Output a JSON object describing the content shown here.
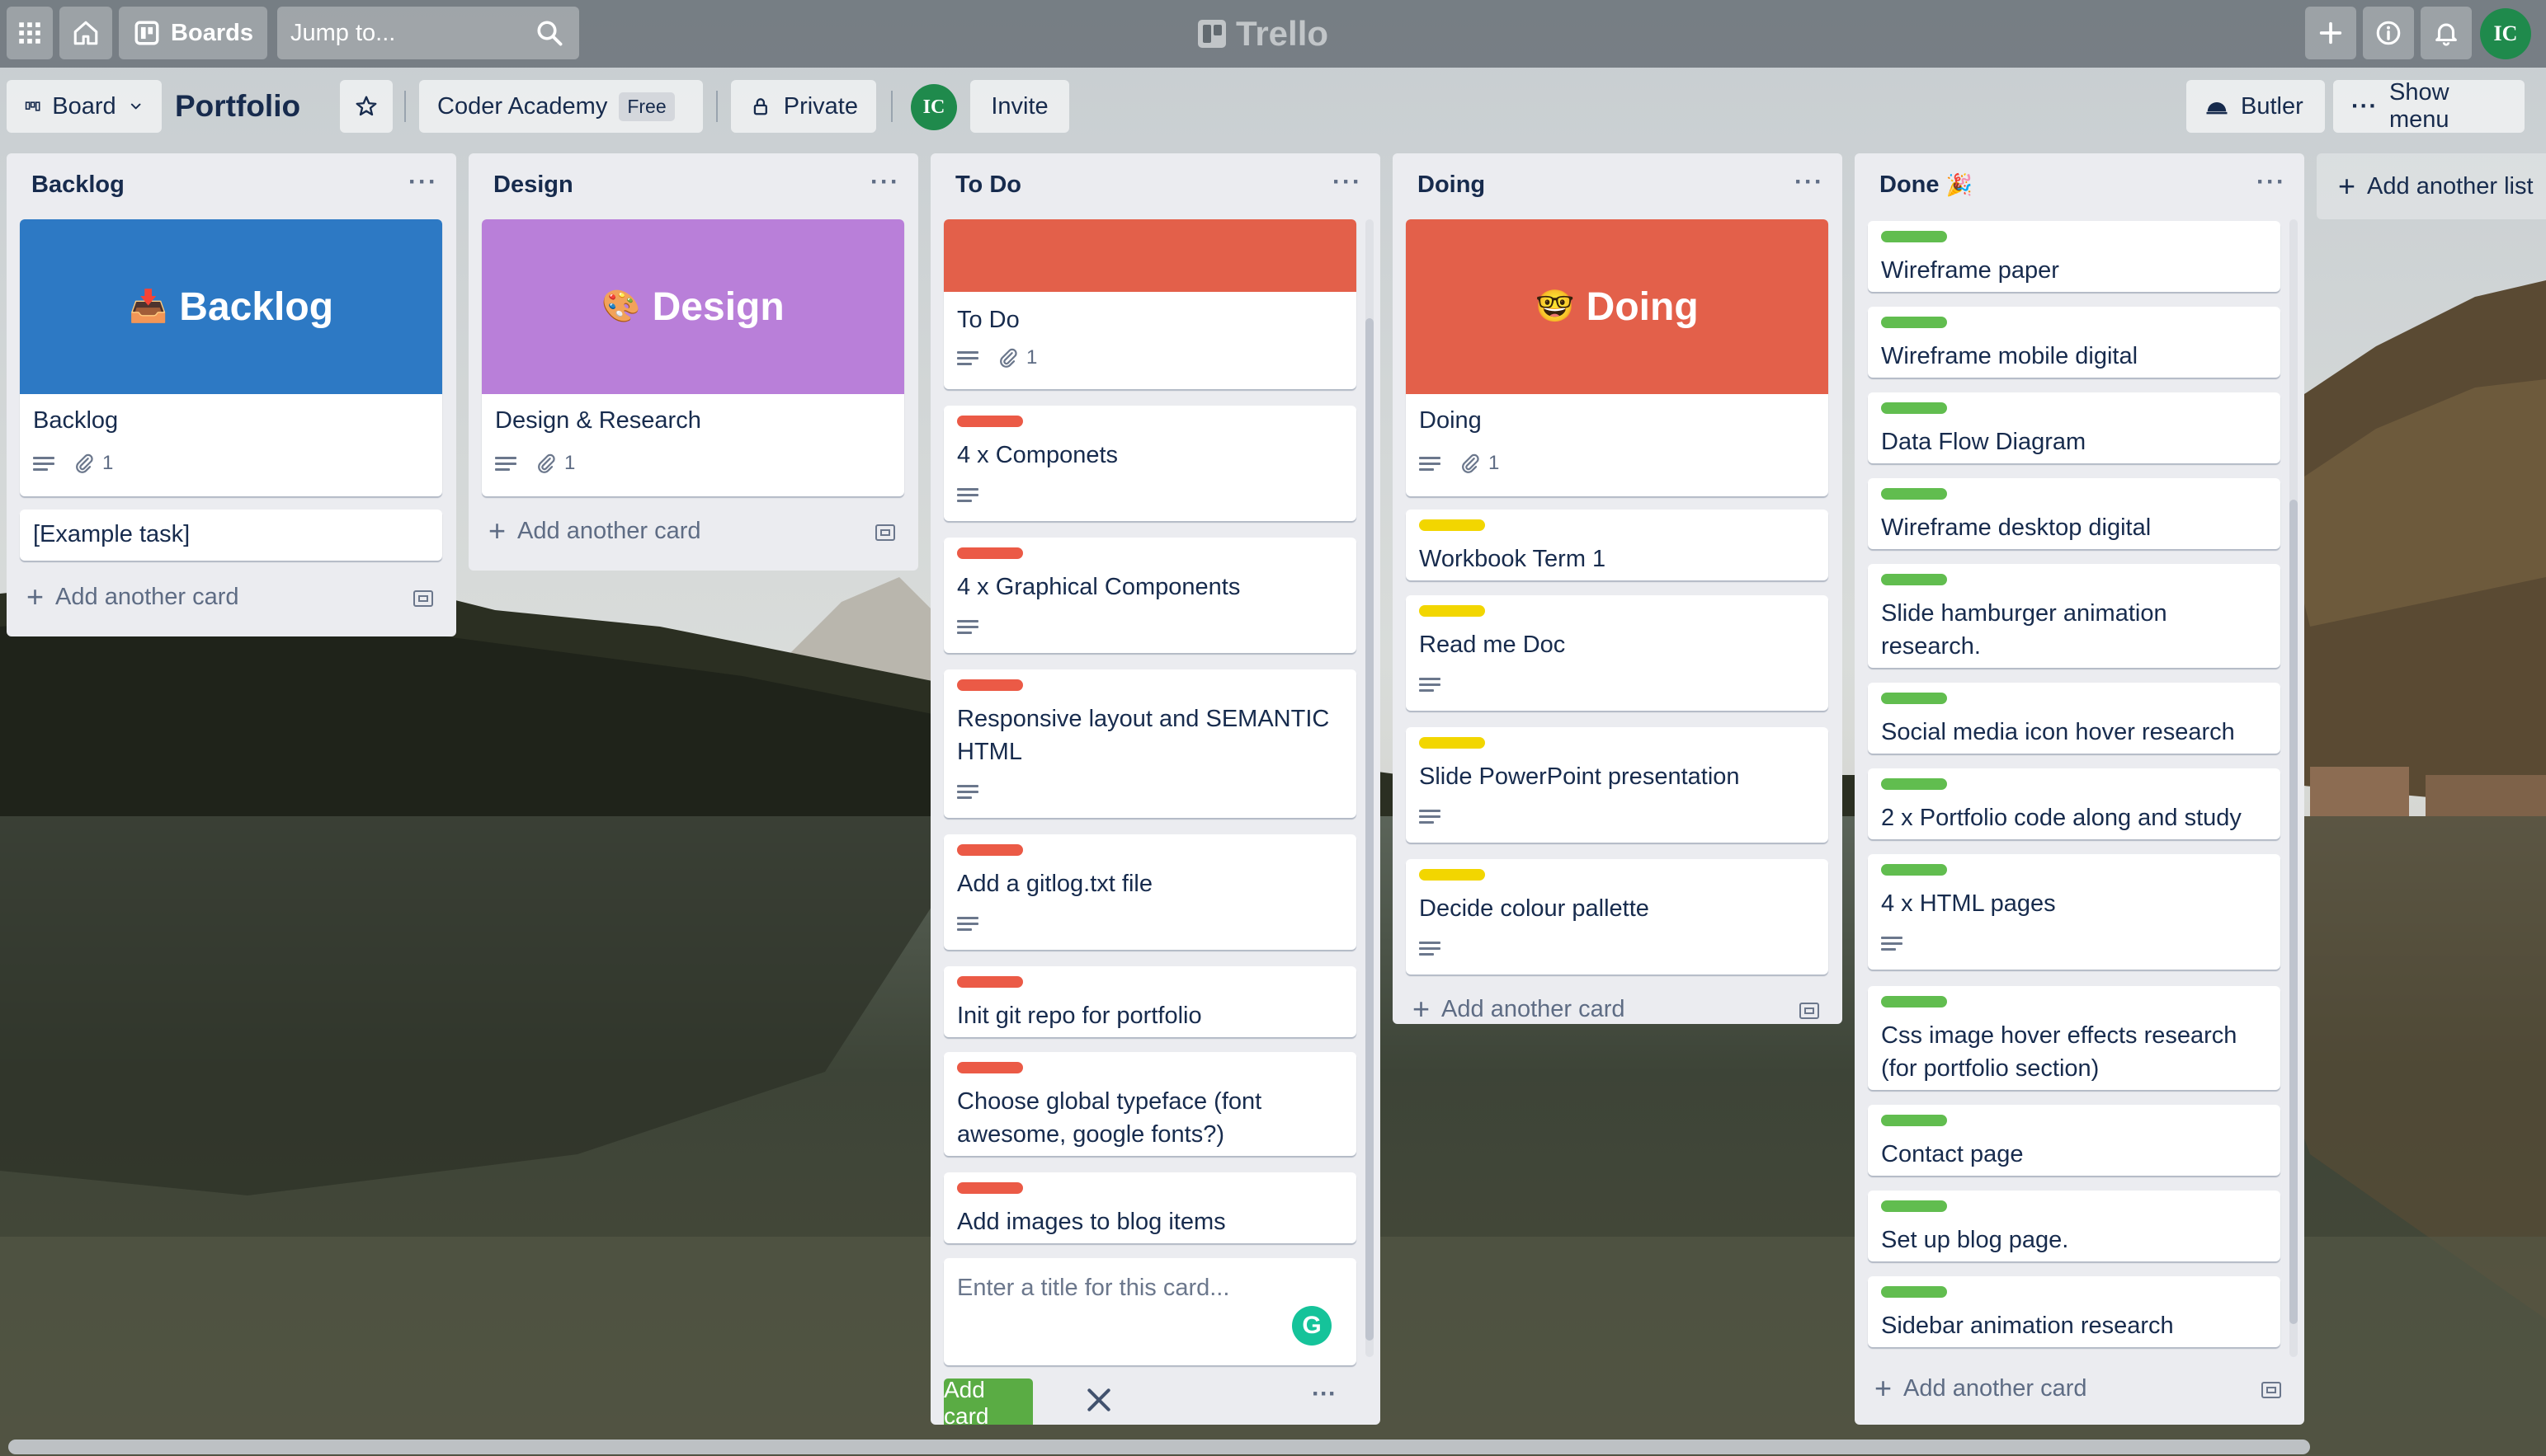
{
  "app": {
    "name": "Trello"
  },
  "topbar": {
    "boards_label": "Boards",
    "search_placeholder": "Jump to...",
    "avatar_initials": "IC"
  },
  "board": {
    "view_label": "Board",
    "title": "Portfolio",
    "team_name": "Coder Academy",
    "team_badge": "Free",
    "visibility": "Private",
    "member_initials": "IC",
    "invite_label": "Invite",
    "butler_label": "Butler",
    "show_menu_label": "Show menu",
    "add_list_label": "Add another list"
  },
  "colors": {
    "backlog_cover": "#2d79c4",
    "design_cover": "#b97fd9",
    "todo_cover": "#e3604a",
    "doing_cover": "#e3604a",
    "red_label": "#eb5a46",
    "yellow_label": "#f2d600",
    "green_label": "#61bd4f",
    "add_button": "#5aac44"
  },
  "lists": [
    {
      "title": "Backlog",
      "cover_card": {
        "cover_text": "Backlog",
        "cover_emoji": "📥",
        "title": "Backlog",
        "attachments": "1"
      },
      "cards": [
        {
          "title": "[Example task]"
        }
      ],
      "add_card_label": "Add another card"
    },
    {
      "title": "Design",
      "cover_card": {
        "cover_text": "Design",
        "cover_emoji": "🎨",
        "title": "Design & Research",
        "attachments": "1"
      },
      "cards": [],
      "add_card_label": "Add another card"
    },
    {
      "title": "To Do",
      "cover_card": {
        "title": "To Do",
        "attachments": "1"
      },
      "cards": [
        {
          "title": "4 x Componets"
        },
        {
          "title": "4 x Graphical Components"
        },
        {
          "title": "Responsive layout and SEMANTIC HTML"
        },
        {
          "title": "Add a gitlog.txt file"
        },
        {
          "title": "Init git repo for portfolio"
        },
        {
          "title": "Choose global typeface (font awesome, google fonts?)"
        },
        {
          "title": "Add images to blog items"
        }
      ],
      "composer": {
        "placeholder": "Enter a title for this card...",
        "add_button": "Add card"
      }
    },
    {
      "title": "Doing",
      "cover_card": {
        "cover_text": "Doing",
        "cover_emoji": "🤓",
        "title": "Doing",
        "attachments": "1"
      },
      "cards": [
        {
          "title": "Workbook Term 1"
        },
        {
          "title": "Read me Doc"
        },
        {
          "title": "Slide PowerPoint presentation"
        },
        {
          "title": "Decide colour pallette"
        }
      ],
      "add_card_label": "Add another card"
    },
    {
      "title": "Done",
      "title_emoji": "🎉",
      "cards": [
        {
          "title": "Wireframe paper"
        },
        {
          "title": "Wireframe mobile digital"
        },
        {
          "title": "Data Flow Diagram"
        },
        {
          "title": "Wireframe desktop digital"
        },
        {
          "title": "Slide hamburger animation research."
        },
        {
          "title": "Social media icon hover research"
        },
        {
          "title": "2 x Portfolio code along and study"
        },
        {
          "title": "4 x HTML pages"
        },
        {
          "title": "Css image hover effects research (for portfolio section)"
        },
        {
          "title": "Contact page"
        },
        {
          "title": "Set up blog page."
        },
        {
          "title": "Sidebar animation research"
        }
      ],
      "add_card_label": "Add another card"
    }
  ]
}
